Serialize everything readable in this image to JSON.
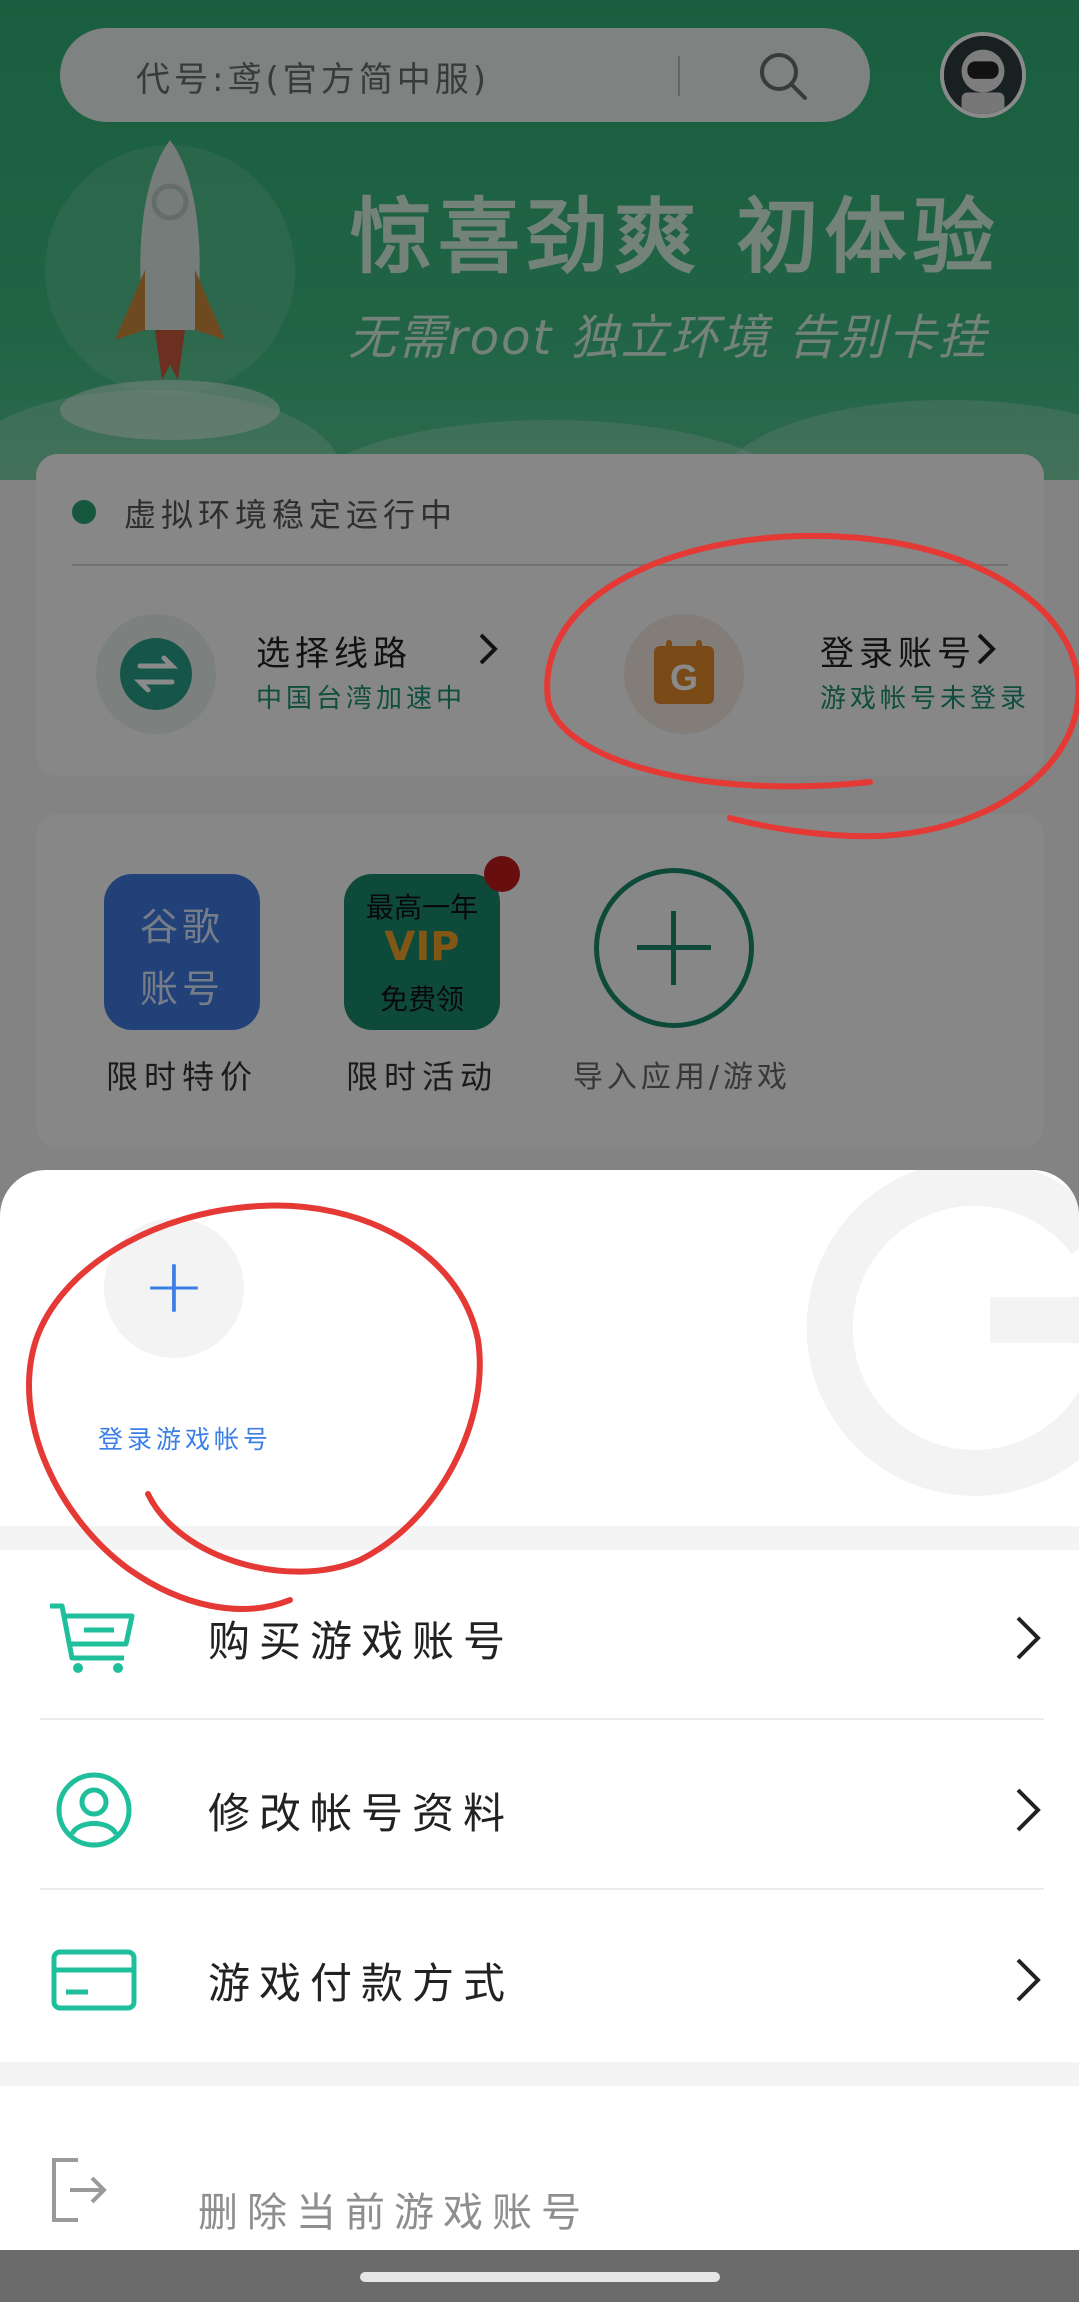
{
  "colors": {
    "accent_green": "#2fae74",
    "teal": "#1fbf9c",
    "blue": "#3b7fe6",
    "annotation_red": "#e53935"
  },
  "search": {
    "text": "代号:鸢(官方简中服)",
    "icon": "search-icon"
  },
  "hero": {
    "title": "惊喜劲爽  初体验",
    "subtitle": "无需root  独立环境  告别卡挂"
  },
  "status_card": {
    "status_text": "虚拟环境稳定运行中",
    "route": {
      "title": "选择线路",
      "subtitle": "中国台湾加速中",
      "icon": "swap-icon"
    },
    "account": {
      "title": "登录账号",
      "subtitle": "游戏帐号未登录",
      "icon": "google-play-icon"
    }
  },
  "tiles": [
    {
      "icon_text": [
        "谷歌",
        "账号"
      ],
      "label": "限时特价"
    },
    {
      "icon_text": [
        "最高一年",
        "VIP",
        "免费领"
      ],
      "label": "限时活动"
    },
    {
      "icon_text": [
        "+"
      ],
      "label": "导入应用/游戏"
    }
  ],
  "sheet": {
    "add_label": "登录游戏帐号",
    "menu": [
      {
        "label": "购买游戏账号",
        "icon": "cart-icon"
      },
      {
        "label": "修改帐号资料",
        "icon": "user-icon"
      },
      {
        "label": "游戏付款方式",
        "icon": "card-icon"
      }
    ],
    "delete_label": "删除当前游戏账号",
    "delete_icon": "logout-icon"
  }
}
